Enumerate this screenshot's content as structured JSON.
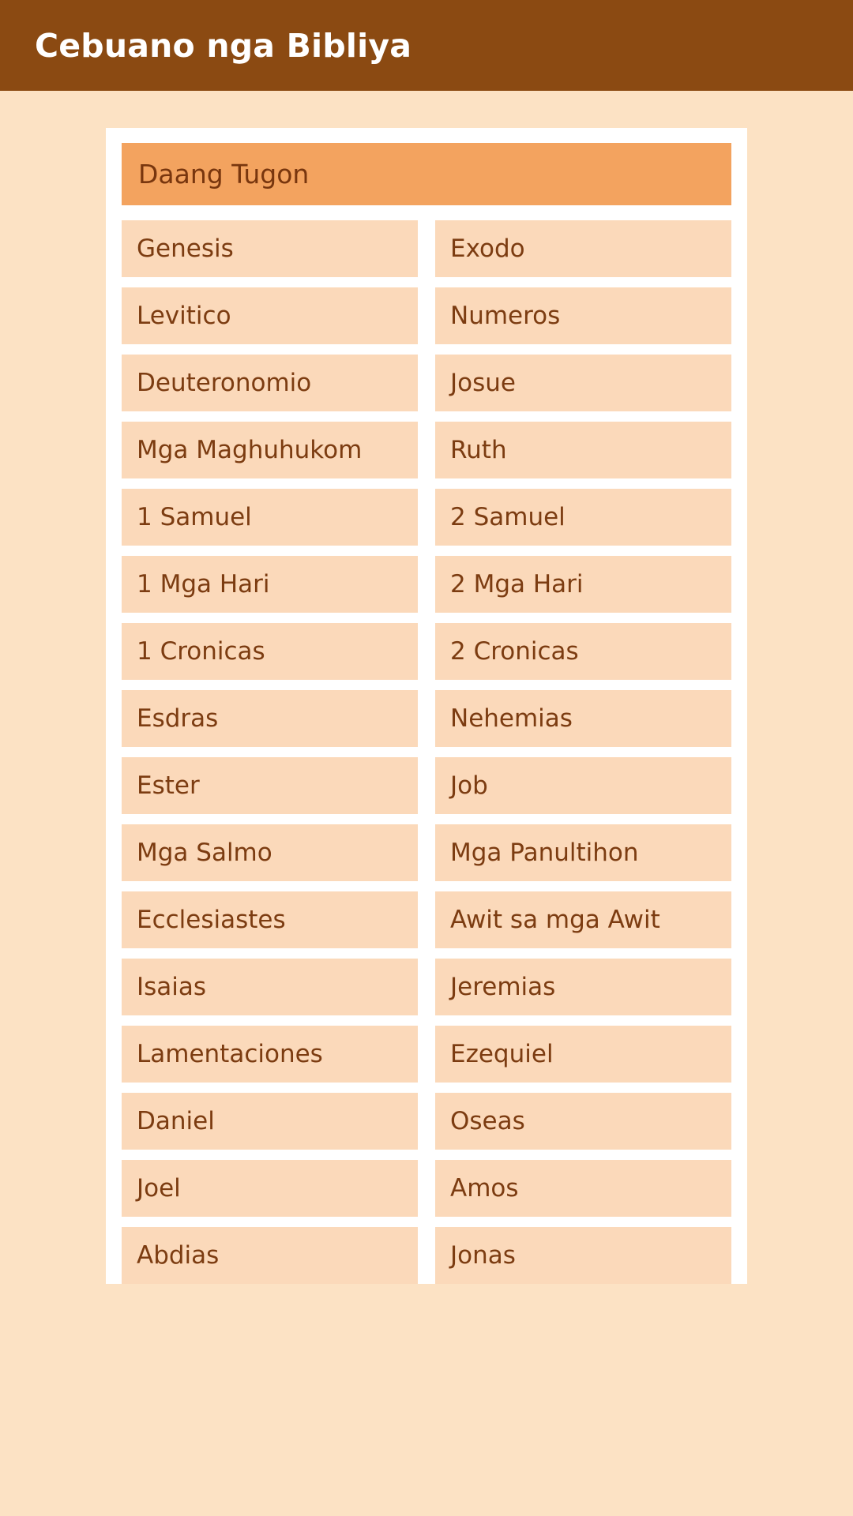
{
  "header": {
    "title": "Cebuano nga Bibliya",
    "background_color": "#8b4a12",
    "text_color": "#ffffff"
  },
  "page": {
    "background_color": "#fce2c4",
    "card_background_color": "#ffffff"
  },
  "testament_section": {
    "label": "Daang Tugon",
    "background_color": "#f3a35f",
    "text_color": "#78360e"
  },
  "tile_style": {
    "background_color": "#fbd9ba",
    "text_color": "#7c3c11"
  },
  "books": [
    "Genesis",
    "Exodo",
    "Levitico",
    "Numeros",
    "Deuteronomio",
    "Josue",
    "Mga Maghuhukom",
    "Ruth",
    "1 Samuel",
    "2 Samuel",
    "1 Mga Hari",
    "2 Mga Hari",
    "1 Cronicas",
    "2 Cronicas",
    "Esdras",
    "Nehemias",
    "Ester",
    "Job",
    "Mga Salmo",
    "Mga Panultihon",
    "Ecclesiastes",
    "Awit sa mga Awit",
    "Isaias",
    "Jeremias",
    "Lamentaciones",
    "Ezequiel",
    "Daniel",
    "Oseas",
    "Joel",
    "Amos",
    "Abdias",
    "Jonas"
  ]
}
